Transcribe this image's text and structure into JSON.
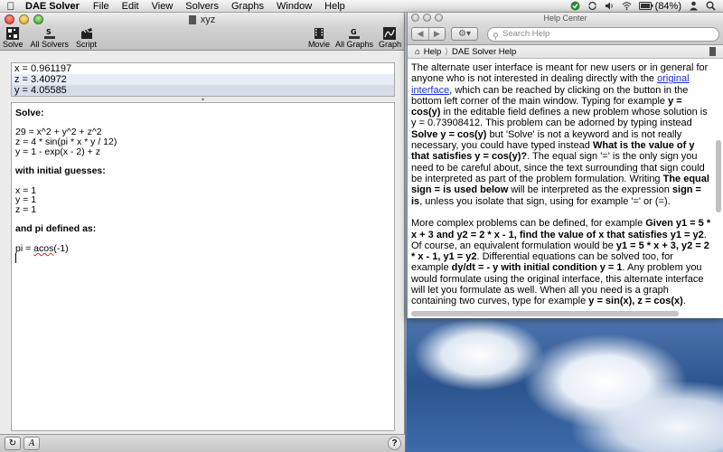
{
  "menubar": {
    "app_name": "DAE Solver",
    "items": [
      "File",
      "Edit",
      "View",
      "Solvers",
      "Graphs",
      "Window",
      "Help"
    ],
    "battery": "(84%)"
  },
  "main_window": {
    "title": "xyz",
    "toolbar": {
      "solve": "Solve",
      "all_solvers": "All Solvers",
      "script": "Script",
      "movie": "Movie",
      "all_graphs": "All Graphs",
      "graph": "Graph"
    },
    "results": [
      "x = 0.961197",
      "z = 3.40972",
      "y = 4.05585"
    ],
    "editor": {
      "heading_solve": "Solve:",
      "eq1": "29 = x^2 + y^2 + z^2",
      "eq2": "z = 4 * sin(pi * x * y / 12)",
      "eq3": "y = 1 - exp(x - 2) + z",
      "heading_guesses": "with initial guesses:",
      "g1": "x = 1",
      "g2": "y = 1",
      "g3": "z = 1",
      "heading_pi": "and pi defined as:",
      "pi_prefix": "pi = ",
      "pi_func": "acos",
      "pi_arg": "(-1)"
    }
  },
  "help_window": {
    "title": "Help Center",
    "search_placeholder": "Search Help",
    "crumb_home": "Help",
    "crumb_page": "DAE Solver Help",
    "para1": {
      "t1": "The alternate user interface is meant for new users or in general for anyone who is not interested in dealing directly with the ",
      "link": "original interface",
      "t2": ", which can be reached by clicking on the button in the bottom left corner of the main window. Typing for example ",
      "b1": "y = cos(y)",
      "t3": " in the editable field defines a new problem whose solution is y = 0.73908412. This problem can be adorned by typing instead ",
      "b2": "Solve y = cos(y)",
      "t4": " but 'Solve' is not a keyword and is not really necessary, you could have typed instead ",
      "b3": "What is the value of y that satisfies y = cos(y)?",
      "t5": ". The equal sign '=' is the only sign you need to be careful about, since the text surrounding that sign could be interpreted as part of the problem formulation. Writing ",
      "b4": "The equal sign = is used below",
      "t6": " will be interpreted as the expression ",
      "b5": "sign = is",
      "t7": ", unless you isolate that sign, using for example '=' or (=)."
    },
    "para2": {
      "t1": "More complex problems can be defined, for example ",
      "b1": "Given y1 = 5 * x + 3 and y2 = 2 * x - 1, find the value of x that satisfies y1 = y2",
      "t2": ". Of course, an equivalent formulation would be ",
      "b2": "y1 = 5 * x + 3, y2 = 2 * x - 1, y1 = y2",
      "t3": ". Differential equations can be solved too, for example ",
      "b3": "dy/dt = - y with initial condition y = 1",
      "t4": ". Any problem you would formulate using the original interface, this alternate interface will let you formulate as well. When all you need is a graph containing two curves, type for example ",
      "b4": "y = sin(x), z = cos(x)",
      "t5": "."
    }
  }
}
